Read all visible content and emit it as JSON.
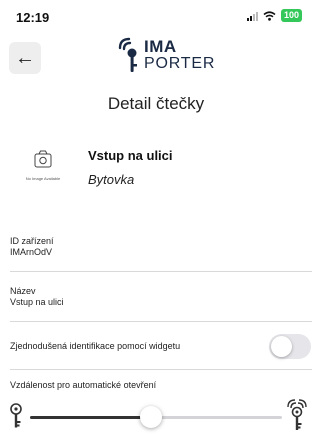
{
  "status_bar": {
    "time": "12:19",
    "battery": "100"
  },
  "header": {
    "back_icon": "arrow-left-icon",
    "logo_line1": "IMA",
    "logo_line2": "PORTER"
  },
  "page": {
    "title": "Detail čtečky"
  },
  "device": {
    "image_caption": "No Image Available",
    "name": "Vstup na ulici",
    "group": "Bytovka"
  },
  "fields": {
    "device_id": {
      "label": "ID zařízení",
      "value": "IMArnOdV"
    },
    "name": {
      "label": "Název",
      "value": "Vstup na ulici"
    }
  },
  "widget_identification": {
    "label": "Zjednodušená identifikace pomocí widgetu",
    "enabled": false
  },
  "auto_open_distance": {
    "label": "Vzdálenost pro automatické otevření",
    "level": 0.48
  },
  "colors": {
    "accent": "#1b2a44",
    "battery": "#34c759",
    "toggle_off": "#e6e6ea"
  }
}
